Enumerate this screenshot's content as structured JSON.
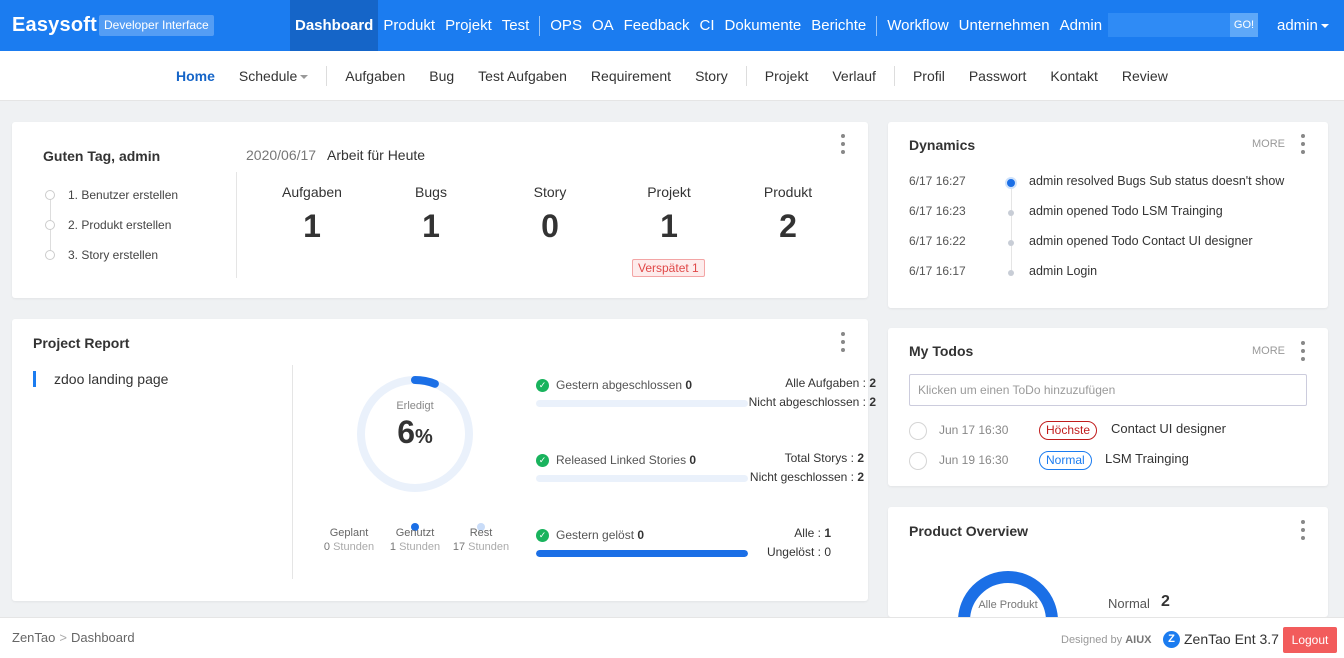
{
  "header": {
    "brand": "Easysoft",
    "badge": "Developer Interface",
    "nav": [
      "Dashboard",
      "Produkt",
      "Projekt",
      "Test",
      "OPS",
      "OA",
      "Feedback",
      "CI",
      "Dokumente",
      "Berichte",
      "Workflow",
      "Unternehmen",
      "Admin"
    ],
    "active": "Dashboard",
    "search_placeholder": "",
    "go_label": "GO!",
    "user": "admin"
  },
  "subnav": {
    "items": [
      "Home",
      "Schedule",
      "Aufgaben",
      "Bug",
      "Test Aufgaben",
      "Requirement",
      "Story",
      "Projekt",
      "Verlauf",
      "Profil",
      "Passwort",
      "Kontakt",
      "Review"
    ],
    "active": "Home"
  },
  "welcome": {
    "greeting": "Guten Tag, admin",
    "date": "2020/06/17",
    "today_label": "Arbeit für Heute",
    "steps": [
      "1. Benutzer erstellen",
      "2. Produkt erstellen",
      "3. Story erstellen"
    ],
    "stats": [
      {
        "label": "Aufgaben",
        "value": "1"
      },
      {
        "label": "Bugs",
        "value": "1"
      },
      {
        "label": "Story",
        "value": "0"
      },
      {
        "label": "Projekt",
        "value": "1"
      },
      {
        "label": "Produkt",
        "value": "2"
      }
    ],
    "late_badge": "Verspätet 1"
  },
  "project_report": {
    "title": "Project Report",
    "project_name": "zdoo landing page",
    "progress_label": "Erledigt",
    "progress_value": "6",
    "progress_unit": "%",
    "progress_fraction": 0.06,
    "hours": [
      {
        "label": "Geplant",
        "value": "0",
        "unit": "Stunden"
      },
      {
        "label": "Genutzt",
        "value": "1",
        "unit": "Stunden"
      },
      {
        "label": "Rest",
        "value": "17",
        "unit": "Stunden"
      }
    ],
    "metrics": [
      {
        "name": "Gestern abgeschlossen",
        "count": "0",
        "lines": [
          {
            "label": "Alle Aufgaben : ",
            "value": "2"
          },
          {
            "label": "Nicht abgeschlossen : ",
            "value": "2"
          }
        ],
        "fill_fraction": 0
      },
      {
        "name": "Released Linked Stories",
        "count": "0",
        "lines": [
          {
            "label": "Total Storys : ",
            "value": "2"
          },
          {
            "label": "Nicht geschlossen : ",
            "value": "2"
          }
        ],
        "fill_fraction": 0
      },
      {
        "name": "Gestern gelöst",
        "count": "0",
        "lines": [
          {
            "label": "Alle : ",
            "value": "1"
          },
          {
            "label": "Ungelöst : ",
            "value": "0"
          }
        ],
        "fill_fraction": 1
      }
    ]
  },
  "dynamics": {
    "title": "Dynamics",
    "more": "MORE",
    "items": [
      {
        "time": "6/17 16:27",
        "text": "admin resolved Bugs Sub status doesn't show"
      },
      {
        "time": "6/17 16:23",
        "text": "admin opened Todo LSM Trainging"
      },
      {
        "time": "6/17 16:22",
        "text": "admin opened Todo Contact UI designer"
      },
      {
        "time": "6/17 16:17",
        "text": "admin Login"
      }
    ]
  },
  "todos": {
    "title": "My Todos",
    "more": "MORE",
    "input_placeholder": "Klicken um einen ToDo hinzuzufügen",
    "items": [
      {
        "date": "Jun 17 16:30",
        "priority": "Höchste",
        "name": "Contact UI designer"
      },
      {
        "date": "Jun 19 16:30",
        "priority": "Normal",
        "name": "LSM Trainging"
      }
    ]
  },
  "product_overview": {
    "title": "Product Overview",
    "ring_label": "Alle Produkt",
    "normal_label": "Normal",
    "normal_value": "2"
  },
  "footer": {
    "crumb_root": "ZenTao",
    "crumb_sep": ">",
    "crumb_page": "Dashboard",
    "designed_by": "Designed by",
    "designer": "AIUX",
    "version": "ZenTao Ent 3.7",
    "logout": "Logout"
  },
  "colors": {
    "brand_blue": "#1b7cf0",
    "active_tab": "#1565c8",
    "danger": "#f25c5c",
    "success": "#19b35d"
  }
}
